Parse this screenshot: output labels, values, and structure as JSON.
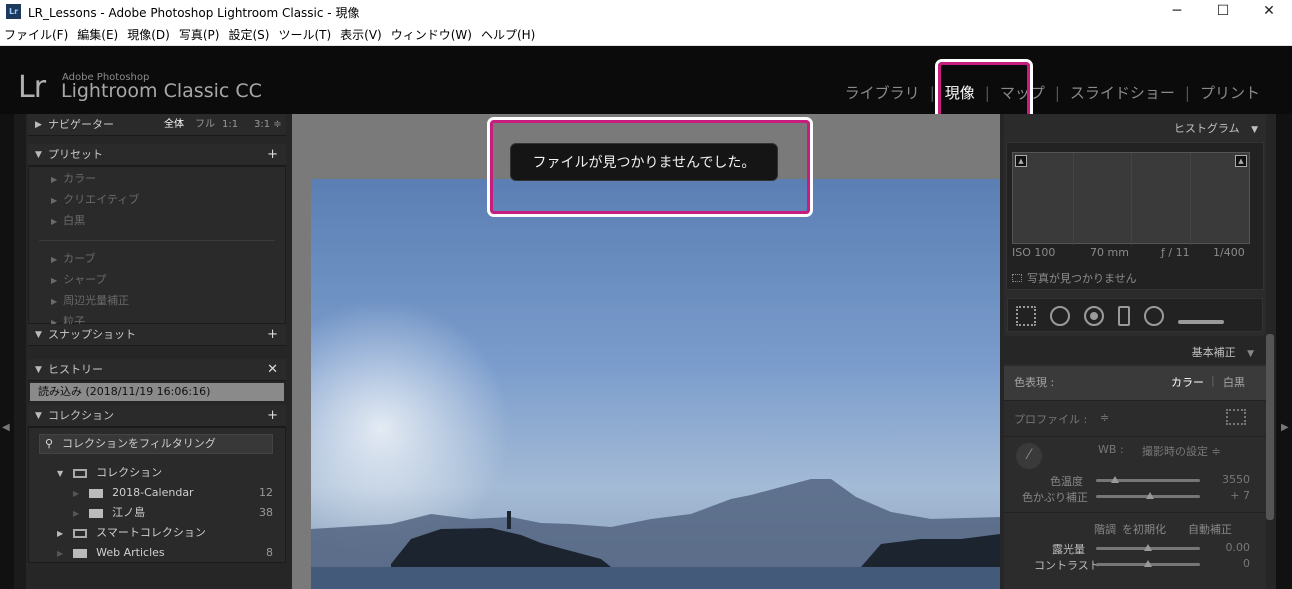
{
  "window": {
    "app_icon_text": "Lr",
    "title": "LR_Lessons - Adobe Photoshop Lightroom Classic - 現像",
    "minimize": "─",
    "maximize": "☐",
    "close": "✕"
  },
  "menu": [
    "ファイル(F)",
    "編集(E)",
    "現像(D)",
    "写真(P)",
    "設定(S)",
    "ツール(T)",
    "表示(V)",
    "ウィンドウ(W)",
    "ヘルプ(H)"
  ],
  "identity": {
    "logo": "Lr",
    "brand_small": "Adobe Photoshop",
    "brand_large": "Lightroom Classic CC"
  },
  "modules": [
    "ライブラリ",
    "現像",
    "マップ",
    "スライドショー",
    "プリント"
  ],
  "left_panel": {
    "navigator": {
      "title": "ナビゲーター",
      "zoom_options": [
        "全体",
        "フル",
        "1:1",
        "3:1 ≑"
      ]
    },
    "presets": {
      "title": "プリセット",
      "items_group1": [
        "カラー",
        "クリエイティブ",
        "白黒"
      ],
      "items_group2": [
        "カーブ",
        "シャープ",
        "周辺光量補正",
        "粒子"
      ]
    },
    "snapshots": {
      "title": "スナップショット"
    },
    "history": {
      "title": "ヒストリー",
      "entry": "読み込み (2018/11/19 16:06:16)"
    },
    "collections": {
      "title": "コレクション",
      "filter_placeholder": "コレクションをフィルタリング",
      "tree": [
        {
          "label": "コレクション",
          "count": ""
        },
        {
          "label": "2018-Calendar",
          "count": "12"
        },
        {
          "label": "江ノ島",
          "count": "38"
        },
        {
          "label": "スマートコレクション",
          "count": ""
        },
        {
          "label": "Web Articles",
          "count": "8"
        }
      ]
    }
  },
  "center": {
    "toast_message": "ファイルが見つかりませんでした。"
  },
  "right_panel": {
    "histogram": {
      "title": "ヒストグラム",
      "iso": "ISO 100",
      "focal": "70 mm",
      "aperture": "ƒ / 11",
      "shutter": "1/400",
      "status": "写真が見つかりません"
    },
    "basic": {
      "title": "基本補正",
      "treatment_label": "色表現 :",
      "treatment_color": "カラー",
      "treatment_bw": "白黒",
      "profile_label": "プロファイル :",
      "profile_value": "≑",
      "wb_label": "WB :",
      "wb_value": "撮影時の設定 ≑",
      "temp_label": "色温度",
      "temp_value": "3550",
      "tint_label": "色かぶり補正",
      "tint_value": "+ 7",
      "tone_label": "階調",
      "tone_reset": "を初期化",
      "tone_auto": "自動補正",
      "exposure_label": "露光量",
      "exposure_value": "0.00",
      "contrast_label": "コントラスト",
      "contrast_value": "0"
    }
  },
  "colors": {
    "highlight": "#c61d7e"
  }
}
